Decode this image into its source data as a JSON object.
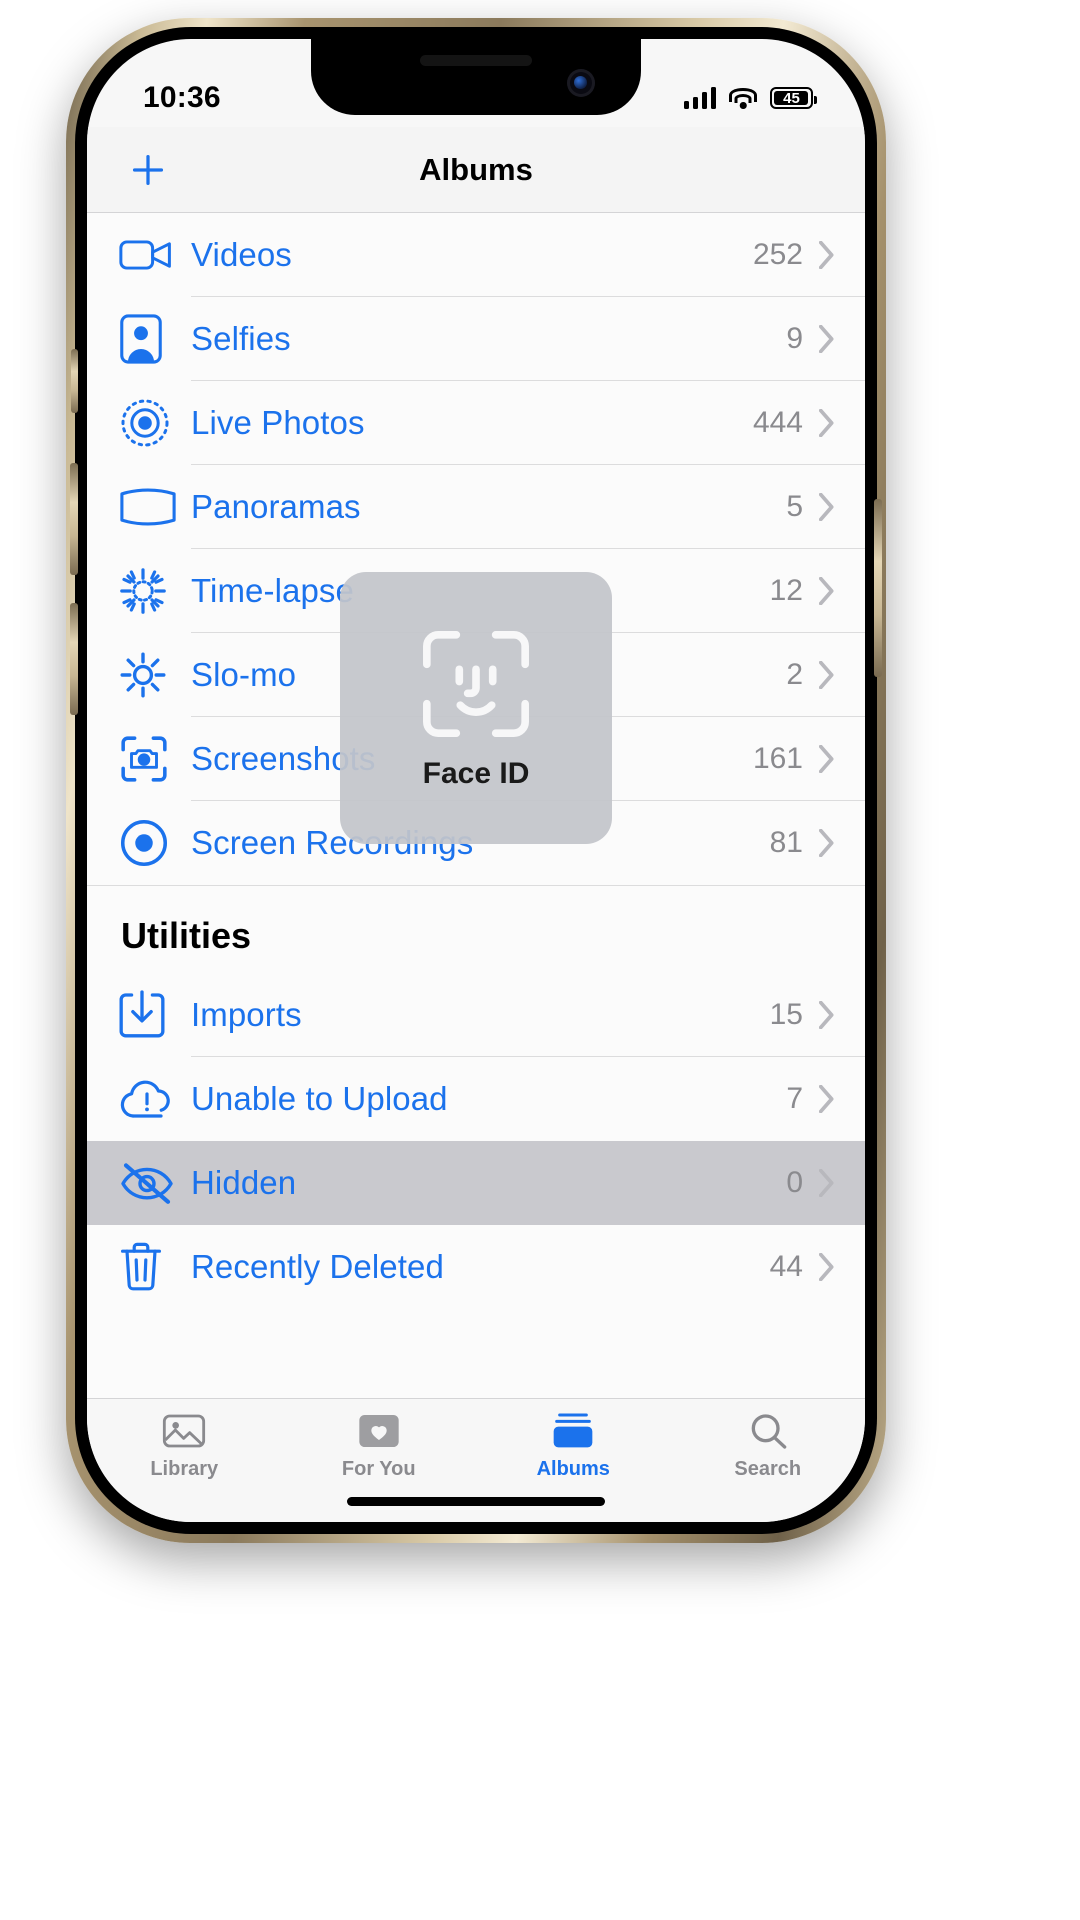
{
  "status_bar": {
    "time": "10:36",
    "battery_level": "45",
    "signal_icon": "cellular-signal-icon",
    "wifi_icon": "wifi-icon",
    "battery_icon": "battery-icon"
  },
  "nav_bar": {
    "title": "Albums",
    "add_icon": "plus-icon"
  },
  "media_types": [
    {
      "label": "Videos",
      "count": "252",
      "icon": "video-camera-icon"
    },
    {
      "label": "Selfies",
      "count": "9",
      "icon": "person-portrait-icon"
    },
    {
      "label": "Live Photos",
      "count": "444",
      "icon": "live-photo-icon"
    },
    {
      "label": "Panoramas",
      "count": "5",
      "icon": "panorama-icon"
    },
    {
      "label": "Time-lapse",
      "count": "12",
      "icon": "timelapse-icon"
    },
    {
      "label": "Slo-mo",
      "count": "2",
      "icon": "slomo-icon"
    },
    {
      "label": "Screenshots",
      "count": "161",
      "icon": "screenshot-camera-icon"
    },
    {
      "label": "Screen Recordings",
      "count": "81",
      "icon": "screen-recording-icon"
    }
  ],
  "utilities": {
    "header": "Utilities",
    "items": [
      {
        "label": "Imports",
        "count": "15",
        "icon": "import-download-icon",
        "selected": false
      },
      {
        "label": "Unable to Upload",
        "count": "7",
        "icon": "cloud-warning-icon",
        "selected": false
      },
      {
        "label": "Hidden",
        "count": "0",
        "icon": "eye-slash-icon",
        "selected": true
      },
      {
        "label": "Recently Deleted",
        "count": "44",
        "icon": "trash-icon",
        "selected": false
      }
    ]
  },
  "face_id_overlay": {
    "label": "Face ID",
    "icon": "face-id-icon"
  },
  "tab_bar": {
    "tabs": [
      {
        "label": "Library",
        "icon": "photos-library-icon",
        "active": false
      },
      {
        "label": "For You",
        "icon": "for-you-icon",
        "active": false
      },
      {
        "label": "Albums",
        "icon": "albums-icon",
        "active": true
      },
      {
        "label": "Search",
        "icon": "search-icon",
        "active": false
      }
    ]
  },
  "colors": {
    "accent": "#1b72ec",
    "selected_row": "#c9c9ce",
    "secondary_text": "#8a8a8e"
  }
}
